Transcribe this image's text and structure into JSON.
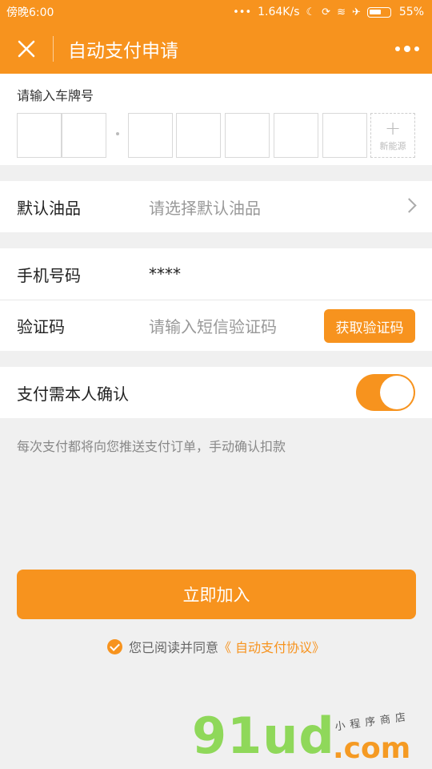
{
  "status_bar": {
    "time": "傍晚6:00",
    "network_speed": "1.64K/s",
    "battery": "55%",
    "icons": [
      "dots-icon",
      "moon-icon",
      "sync-icon",
      "wifi-icon",
      "airplane-icon",
      "battery-icon"
    ]
  },
  "nav": {
    "title": "自动支付申请",
    "close_icon": "close-icon",
    "more_icon": "more-dots-icon"
  },
  "plate": {
    "label": "请输入车牌号",
    "new_energy_plus": "+",
    "new_energy_label": "新能源"
  },
  "fuel": {
    "label": "默认油品",
    "placeholder": "请选择默认油品"
  },
  "phone": {
    "label": "手机号码",
    "value": "****"
  },
  "code": {
    "label": "验证码",
    "placeholder": "请输入短信验证码",
    "button": "获取验证码"
  },
  "confirm": {
    "label": "支付需本人确认",
    "toggle_on": true,
    "hint": "每次支付都将向您推送支付订单，手动确认扣款"
  },
  "submit": {
    "label": "立即加入"
  },
  "agreement": {
    "text": "您已阅读并同意",
    "link": "《 自动支付协议》"
  },
  "watermark": {
    "main": "91ud",
    "com": ".com",
    "tag": "小程序商店"
  },
  "colors": {
    "accent": "#f7931e",
    "background": "#f0f0f0"
  }
}
